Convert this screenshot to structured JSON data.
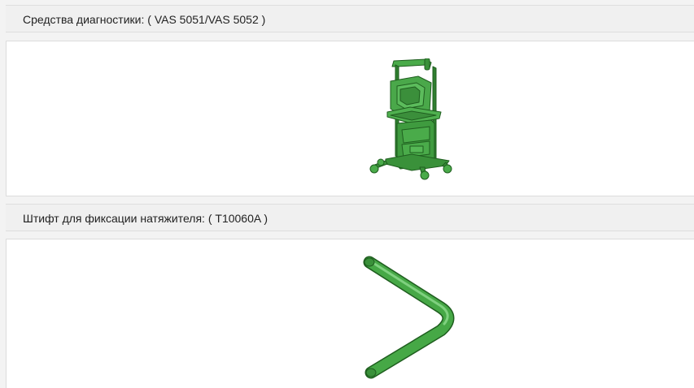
{
  "tools": [
    {
      "title": "Средства диагностики: ( VAS 5051/VAS 5052 )",
      "image_icon": "diagnostic-cart-icon",
      "image_color": "#3a9a3a"
    },
    {
      "title": "Штифт для фиксации натяжителя: ( T10060A )",
      "image_icon": "locking-pin-icon",
      "image_color": "#3a9a3a"
    }
  ]
}
